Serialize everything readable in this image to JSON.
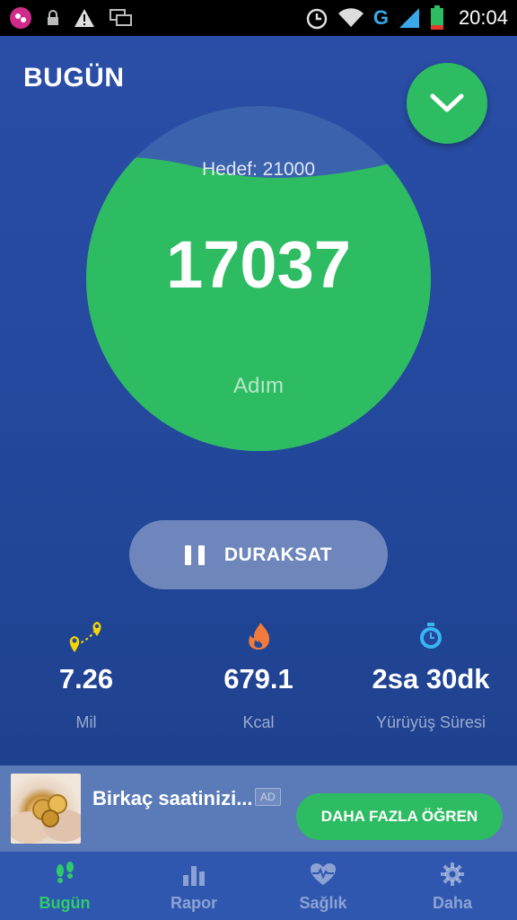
{
  "status_bar": {
    "time": "20:04",
    "network": "G",
    "icons": [
      "app-notification-icon",
      "lock-icon",
      "warning-icon",
      "screens-icon",
      "alarm-icon",
      "wifi-icon",
      "signal-icon",
      "battery-icon"
    ]
  },
  "header": {
    "title": "BUGÜN",
    "expand_icon": "chevron-down-icon"
  },
  "progress": {
    "goal_text": "Hedef: 21000",
    "steps": "17037",
    "steps_label": "Adım",
    "fraction": 0.81
  },
  "pause_button": {
    "label": "DURAKSAT",
    "icon": "pause-icon"
  },
  "stats": [
    {
      "icon": "map-pin-route-icon",
      "value": "7.26",
      "label": "Mil"
    },
    {
      "icon": "flame-icon",
      "value": "679.1",
      "label": "Kcal"
    },
    {
      "icon": "stopwatch-icon",
      "value": "2sa 30dk",
      "label": "Yürüyüş Süresi"
    }
  ],
  "ad": {
    "title": "Birkaç saatinizi...",
    "badge": "AD",
    "cta": "DAHA FAZLA ÖĞREN"
  },
  "nav": [
    {
      "label": "Bugün",
      "icon": "footsteps-icon",
      "active": true
    },
    {
      "label": "Rapor",
      "icon": "bar-chart-icon",
      "active": false
    },
    {
      "label": "Sağlık",
      "icon": "heart-pulse-icon",
      "active": false
    },
    {
      "label": "Daha",
      "icon": "gear-icon",
      "active": false
    }
  ],
  "colors": {
    "accent_green": "#2ebc63",
    "background_blue": "#23489c",
    "nav_blue": "#2f57b0"
  }
}
